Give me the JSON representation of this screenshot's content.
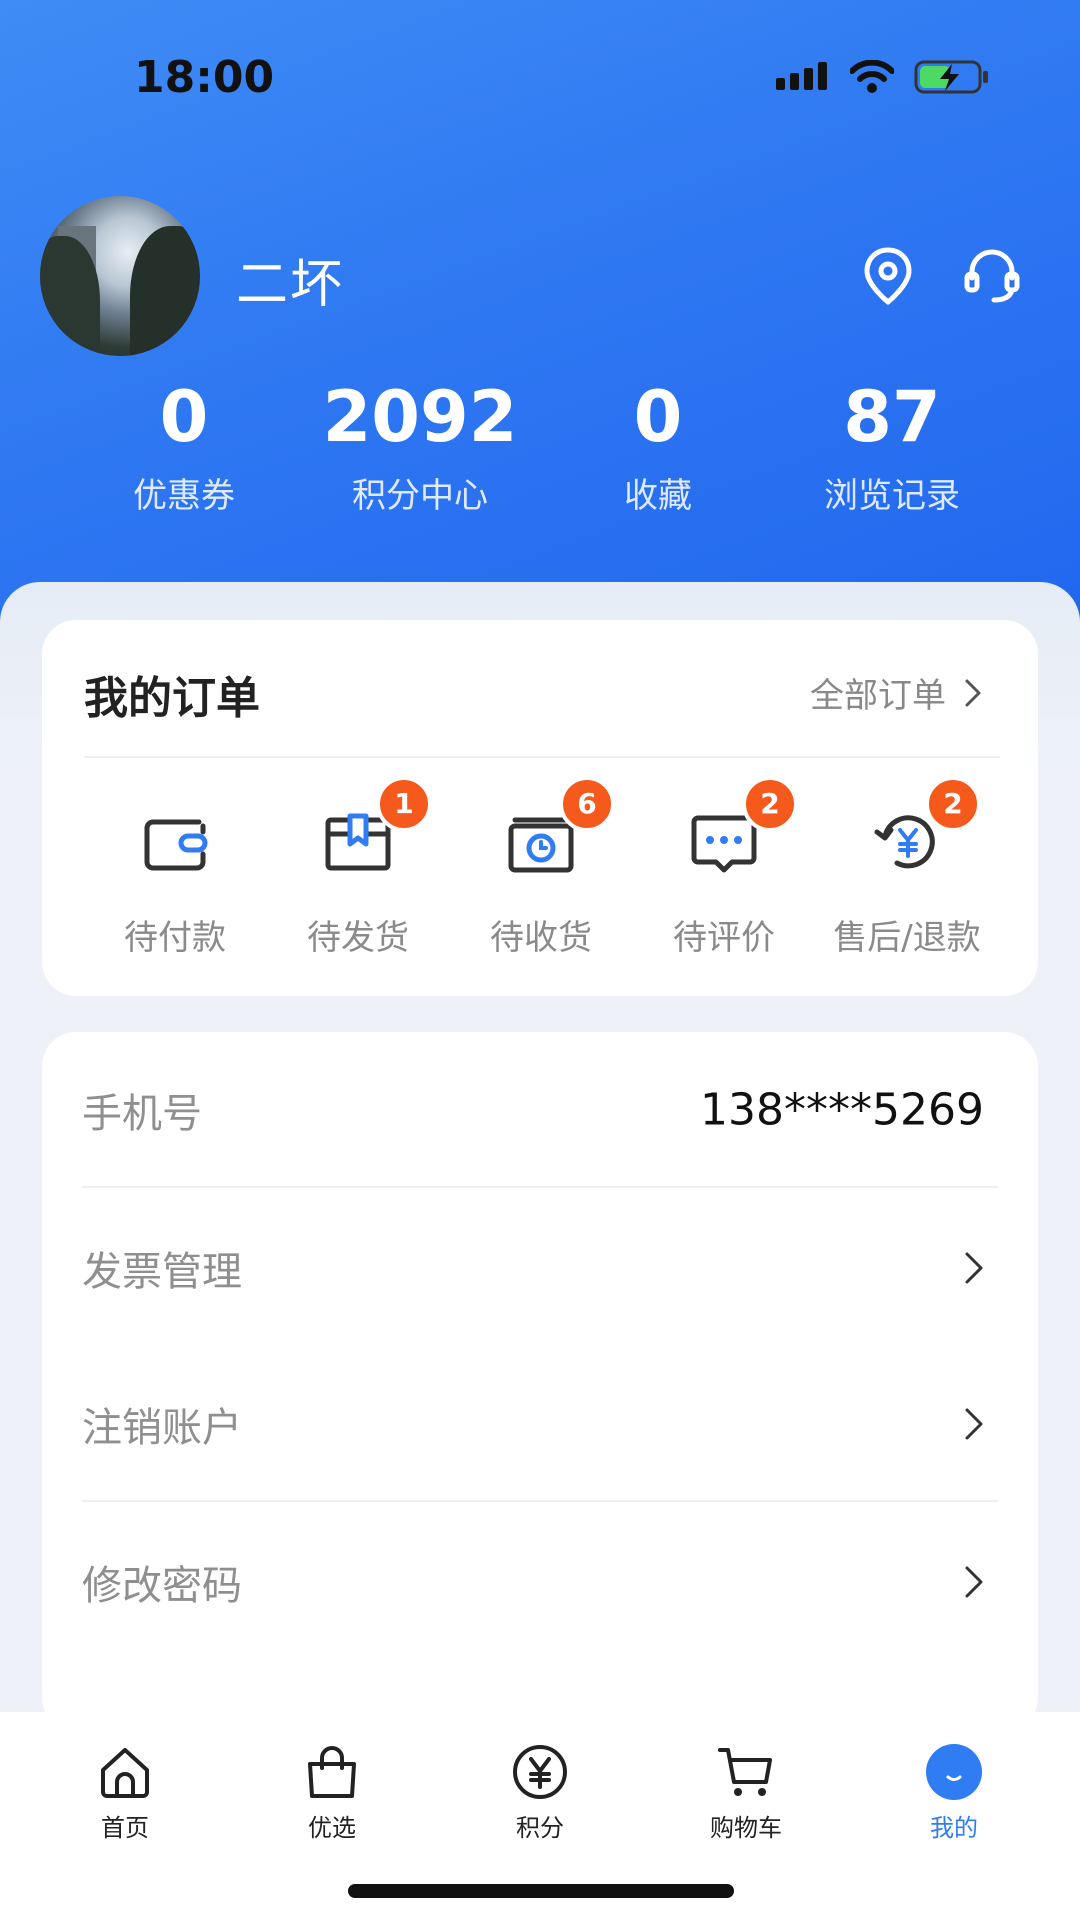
{
  "status_bar": {
    "time": "18:00"
  },
  "profile": {
    "username": "二坏"
  },
  "stats": [
    {
      "value": "0",
      "label": "优惠券"
    },
    {
      "value": "2092",
      "label": "积分中心"
    },
    {
      "value": "0",
      "label": "收藏"
    },
    {
      "value": "87",
      "label": "浏览记录"
    }
  ],
  "orders": {
    "title": "我的订单",
    "all_label": "全部订单",
    "items": [
      {
        "label": "待付款",
        "icon": "wallet-icon",
        "badge": ""
      },
      {
        "label": "待发货",
        "icon": "package-icon",
        "badge": "1"
      },
      {
        "label": "待收货",
        "icon": "delivery-clock-icon",
        "badge": "6"
      },
      {
        "label": "待评价",
        "icon": "chat-bubble-icon",
        "badge": "2"
      },
      {
        "label": "售后/退款",
        "icon": "refund-icon",
        "badge": "2"
      }
    ]
  },
  "settings": {
    "phone_label": "手机号",
    "phone_value": "138****5269",
    "invoice_label": "发票管理",
    "deactivate_label": "注销账户",
    "password_label": "修改密码"
  },
  "tabbar": {
    "items": [
      {
        "label": "首页",
        "icon": "home-icon"
      },
      {
        "label": "优选",
        "icon": "shopping-bag-icon"
      },
      {
        "label": "积分",
        "icon": "yuan-coin-icon"
      },
      {
        "label": "购物车",
        "icon": "cart-icon"
      },
      {
        "label": "我的",
        "icon": "profile-icon"
      }
    ],
    "active": "我的",
    "active_color": "#2f7cf3"
  },
  "colors": {
    "primary": "#2f78f2",
    "badge": "#f55a1c"
  }
}
